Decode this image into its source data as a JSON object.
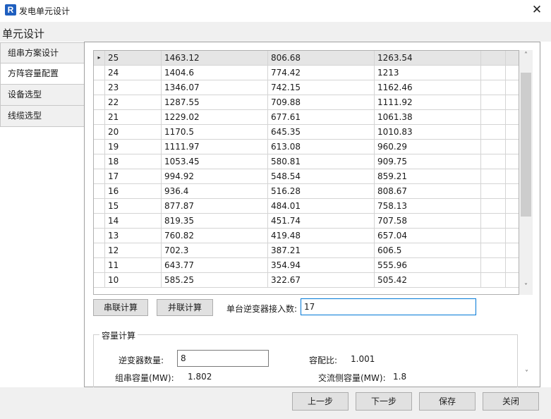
{
  "window": {
    "title": "发电单元设计",
    "app_icon_letter": "R",
    "close_glyph": "✕"
  },
  "header": {
    "title": "单元设计"
  },
  "nav": {
    "items": [
      "组串方案设计",
      "方阵容量配置",
      "设备选型",
      "线缆选型"
    ],
    "active_index": 1
  },
  "table": {
    "current_row_marker": "▸",
    "rows": [
      [
        "25",
        "1463.12",
        "806.68",
        "1263.54"
      ],
      [
        "24",
        "1404.6",
        "774.42",
        "1213"
      ],
      [
        "23",
        "1346.07",
        "742.15",
        "1162.46"
      ],
      [
        "22",
        "1287.55",
        "709.88",
        "1111.92"
      ],
      [
        "21",
        "1229.02",
        "677.61",
        "1061.38"
      ],
      [
        "20",
        "1170.5",
        "645.35",
        "1010.83"
      ],
      [
        "19",
        "1111.97",
        "613.08",
        "960.29"
      ],
      [
        "18",
        "1053.45",
        "580.81",
        "909.75"
      ],
      [
        "17",
        "994.92",
        "548.54",
        "859.21"
      ],
      [
        "16",
        "936.4",
        "516.28",
        "808.67"
      ],
      [
        "15",
        "877.87",
        "484.01",
        "758.13"
      ],
      [
        "14",
        "819.35",
        "451.74",
        "707.58"
      ],
      [
        "13",
        "760.82",
        "419.48",
        "657.04"
      ],
      [
        "12",
        "702.3",
        "387.21",
        "606.5"
      ],
      [
        "11",
        "643.77",
        "354.94",
        "555.96"
      ],
      [
        "10",
        "585.25",
        "322.67",
        "505.42"
      ]
    ]
  },
  "scroll": {
    "up_glyph": "˄",
    "down_glyph": "˅"
  },
  "controls": {
    "series_button": "串联计算",
    "parallel_button": "并联计算",
    "inverter_input_label": "单台逆变器接入数:",
    "inverter_input_value": "17"
  },
  "capacity": {
    "group_title": "容量计算",
    "inverter_count_label": "逆变器数量:",
    "inverter_count_value": "8",
    "ratio_label": "容配比:",
    "ratio_value": "1.001",
    "string_capacity_label": "组串容量(MW):",
    "string_capacity_value": "1.802",
    "ac_capacity_label": "交流侧容量(MW):",
    "ac_capacity_value": "1.8"
  },
  "footer": {
    "prev": "上一步",
    "next": "下一步",
    "save": "保存",
    "close": "关闭"
  }
}
